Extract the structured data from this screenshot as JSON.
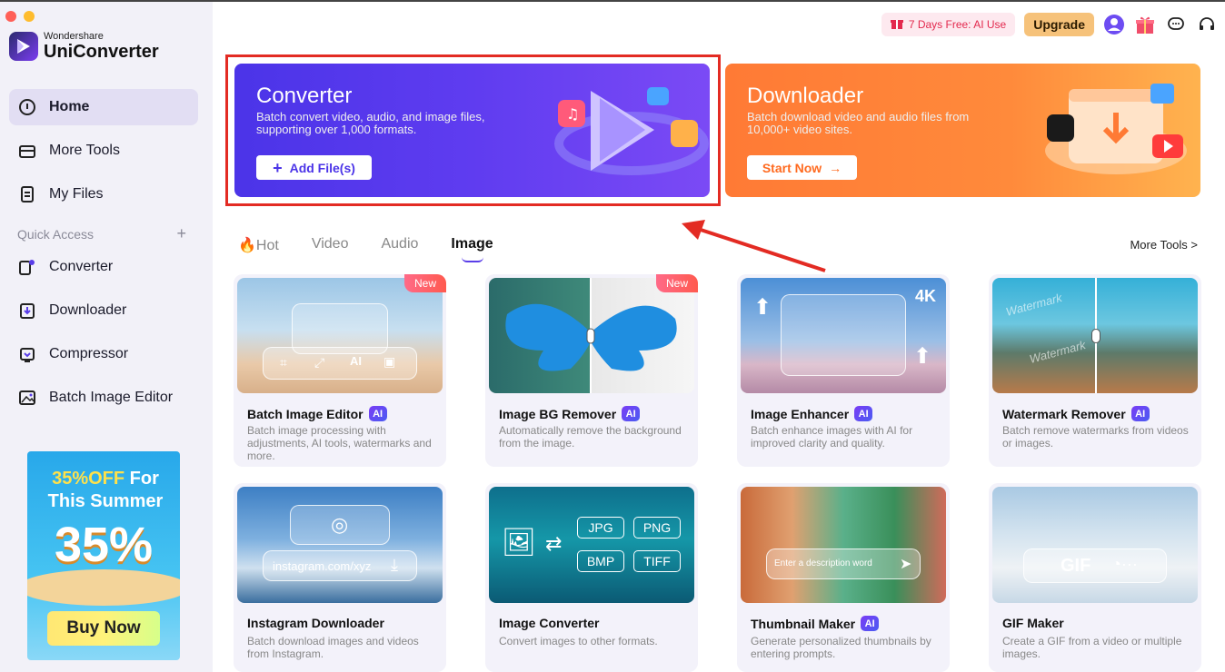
{
  "app": {
    "brand_small": "Wondershare",
    "brand_large": "UniConverter"
  },
  "sidebar": {
    "items": [
      {
        "label": "Home",
        "icon": "home-icon"
      },
      {
        "label": "More Tools",
        "icon": "toolbox-icon"
      },
      {
        "label": "My Files",
        "icon": "file-icon"
      }
    ],
    "quick_access_label": "Quick Access",
    "quick_access_add": "+",
    "quick_items": [
      {
        "label": "Converter",
        "icon": "converter-icon"
      },
      {
        "label": "Downloader",
        "icon": "downloader-icon"
      },
      {
        "label": "Compressor",
        "icon": "compressor-icon"
      },
      {
        "label": "Batch Image Editor",
        "icon": "image-editor-icon"
      }
    ]
  },
  "promo": {
    "line1_a": "35%OFF",
    "line1_b": " For",
    "line2": "This Summer",
    "big": "35%",
    "button": "Buy Now"
  },
  "header": {
    "trial": "7 Days Free: AI Use",
    "upgrade": "Upgrade"
  },
  "banners": {
    "converter": {
      "title": "Converter",
      "desc": "Batch convert video, audio, and image files, supporting over 1,000 formats.",
      "button": "Add File(s)"
    },
    "downloader": {
      "title": "Downloader",
      "desc": "Batch download video and audio files from 10,000+ video sites.",
      "button": "Start Now"
    }
  },
  "tabs": [
    {
      "label": "Hot",
      "icon": "fire-icon"
    },
    {
      "label": "Video"
    },
    {
      "label": "Audio"
    },
    {
      "label": "Image",
      "active": true
    }
  ],
  "more_tools": "More Tools >",
  "cards": [
    {
      "title": "Batch Image Editor",
      "ai": "AI",
      "badge": "New",
      "desc": "Batch image processing with adjustments, AI tools, watermarks and more."
    },
    {
      "title": "Image BG Remover",
      "ai": "AI",
      "badge": "New",
      "desc": "Automatically remove the background from the image."
    },
    {
      "title": "Image Enhancer",
      "ai": "AI",
      "overlay": "4K",
      "desc": "Batch enhance images with AI for improved clarity and quality."
    },
    {
      "title": "Watermark Remover",
      "ai": "AI",
      "desc": "Batch remove watermarks from videos or images.",
      "watermark": "Watermark"
    },
    {
      "title": "Instagram Downloader",
      "desc": "Batch download images and videos from Instagram.",
      "overlay": "instagram.com/xyz"
    },
    {
      "title": "Image Converter",
      "desc": "Convert images to other formats.",
      "formats": [
        "JPG",
        "PNG",
        "BMP",
        "TIFF"
      ]
    },
    {
      "title": "Thumbnail Maker",
      "ai": "AI",
      "desc": "Generate personalized thumbnails by entering prompts.",
      "overlay": "Enter a description word"
    },
    {
      "title": "GIF Maker",
      "desc": "Create a GIF from a video or multiple images.",
      "overlay": "GIF"
    }
  ]
}
